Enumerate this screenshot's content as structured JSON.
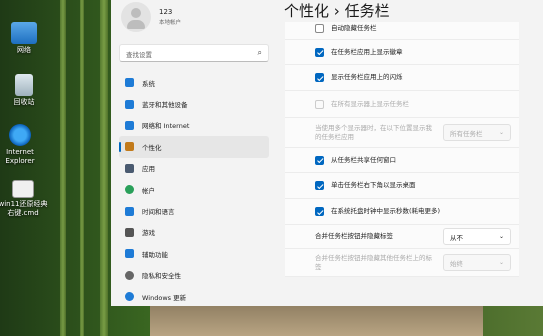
{
  "desktop": {
    "icons": [
      {
        "label": "网络",
        "icon": "network-icon"
      },
      {
        "label": "回收站",
        "icon": "recycle-bin-icon"
      },
      {
        "label": "Internet Explorer",
        "icon": "ie-icon"
      },
      {
        "label": "win11还原经典右键.cmd",
        "icon": "cmd-file-icon"
      }
    ]
  },
  "user": {
    "name": "123",
    "type": "本地帐户"
  },
  "search": {
    "placeholder": "查找设置"
  },
  "nav": [
    {
      "label": "系统",
      "icon": "system-icon",
      "color": "#1e7bd6"
    },
    {
      "label": "蓝牙和其他设备",
      "icon": "bluetooth-icon",
      "color": "#1e7bd6"
    },
    {
      "label": "网络和 Internet",
      "icon": "network-wifi-icon",
      "color": "#1e7bd6"
    },
    {
      "label": "个性化",
      "icon": "personalization-brush-icon",
      "color": "#c27a1a",
      "active": true
    },
    {
      "label": "应用",
      "icon": "apps-icon",
      "color": "#4a5a70"
    },
    {
      "label": "帐户",
      "icon": "account-icon",
      "color": "#2aa05a"
    },
    {
      "label": "时间和语言",
      "icon": "time-language-icon",
      "color": "#1e7bd6"
    },
    {
      "label": "游戏",
      "icon": "gaming-icon",
      "color": "#555"
    },
    {
      "label": "辅助功能",
      "icon": "accessibility-icon",
      "color": "#1e7bd6"
    },
    {
      "label": "隐私和安全性",
      "icon": "privacy-shield-icon",
      "color": "#666"
    },
    {
      "label": "Windows 更新",
      "icon": "windows-update-icon",
      "color": "#1e7bd6"
    }
  ],
  "breadcrumb": {
    "parent": "个性化",
    "separator": "›",
    "current": "任务栏"
  },
  "options": [
    {
      "label": "自动隐藏任务栏",
      "checked": false,
      "disabled": false
    },
    {
      "label": "在任务栏应用上显示徽章",
      "checked": true,
      "disabled": false
    },
    {
      "label": "显示任务栏应用上的闪烁",
      "checked": true,
      "disabled": false
    },
    {
      "label": "在所有显示器上显示任务栏",
      "checked": false,
      "disabled": true
    }
  ],
  "multi_monitor": {
    "label": "当使用多个显示器时，在以下位置显示我的任务栏应用",
    "value": "所有任务栏",
    "disabled": true
  },
  "options2": [
    {
      "label": "从任务栏共享任何窗口",
      "checked": true,
      "disabled": false
    },
    {
      "label": "单击任务栏右下角以显示桌面",
      "checked": true,
      "disabled": false
    },
    {
      "label": "在系统托盘时钟中显示秒数(耗电更多)",
      "checked": true,
      "disabled": false
    }
  ],
  "combine_main": {
    "label": "合并任务栏按钮并隐藏标签",
    "value": "从不",
    "disabled": false
  },
  "combine_other": {
    "label": "合并任务栏按钮并隐藏其他任务栏上的标签",
    "value": "始终",
    "disabled": true
  },
  "colors": {
    "accent": "#0067c0"
  }
}
